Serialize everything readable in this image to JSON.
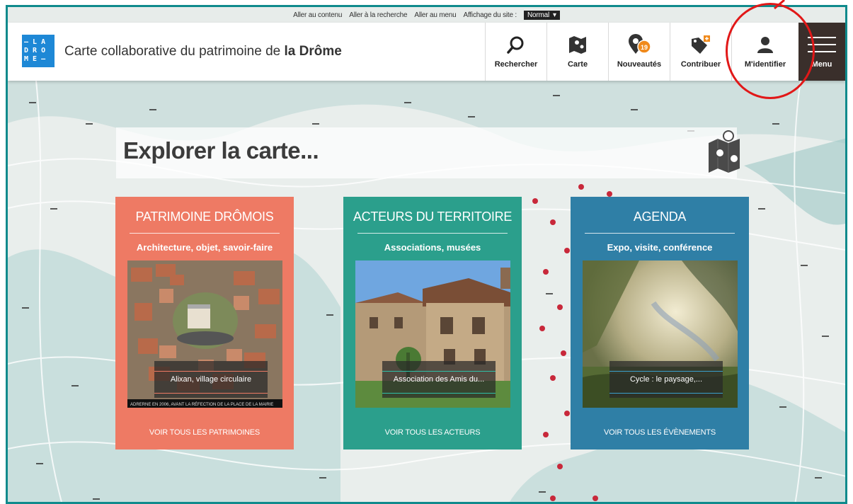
{
  "skip_links": {
    "content": "Aller au contenu",
    "search": "Aller à la recherche",
    "menu": "Aller au menu",
    "display_label": "Affichage du site :",
    "display_value": "Normal"
  },
  "header": {
    "logo_lines": [
      "– L A",
      "D R O",
      "M E –"
    ],
    "title_prefix": "Carte collaborative du patrimoine de ",
    "title_bold": "la Drôme"
  },
  "nav": {
    "search": "Rechercher",
    "map": "Carte",
    "news": "Nouveautés",
    "news_badge": "19",
    "contribute": "Contribuer",
    "login": "M'identifier",
    "menu": "Menu"
  },
  "explore": {
    "title": "Explorer la carte..."
  },
  "cards": [
    {
      "title": "PATRIMOINE DRÔMOIS",
      "subtitle": "Architecture, objet, savoir-faire",
      "caption": "Alixan, village circulaire",
      "link": "VOIR TOUS LES PATRIMOINES",
      "photo_strip": "ADRERNE EN 2006, AVANT LA RÉFECTION DE LA PLACE DE LA MAIRIE"
    },
    {
      "title": "ACTEURS DU TERRITOIRE",
      "subtitle": "Associations, musées",
      "caption": "Association des Amis du...",
      "link": "VOIR TOUS LES ACTEURS"
    },
    {
      "title": "AGENDA",
      "subtitle": "Expo, visite, conférence",
      "caption": "Cycle : le paysage,...",
      "link": "VOIR TOUS LES ÉVÈNEMENTS"
    }
  ],
  "colors": {
    "frame": "#0f8a8c",
    "patrimoine": "#ee7a64",
    "acteurs": "#2b9f8c",
    "agenda": "#2f7fa6",
    "logo": "#1e88d6",
    "menu_bg": "#3a2f2b",
    "badge": "#f08a1c",
    "annotation": "#e11818"
  }
}
